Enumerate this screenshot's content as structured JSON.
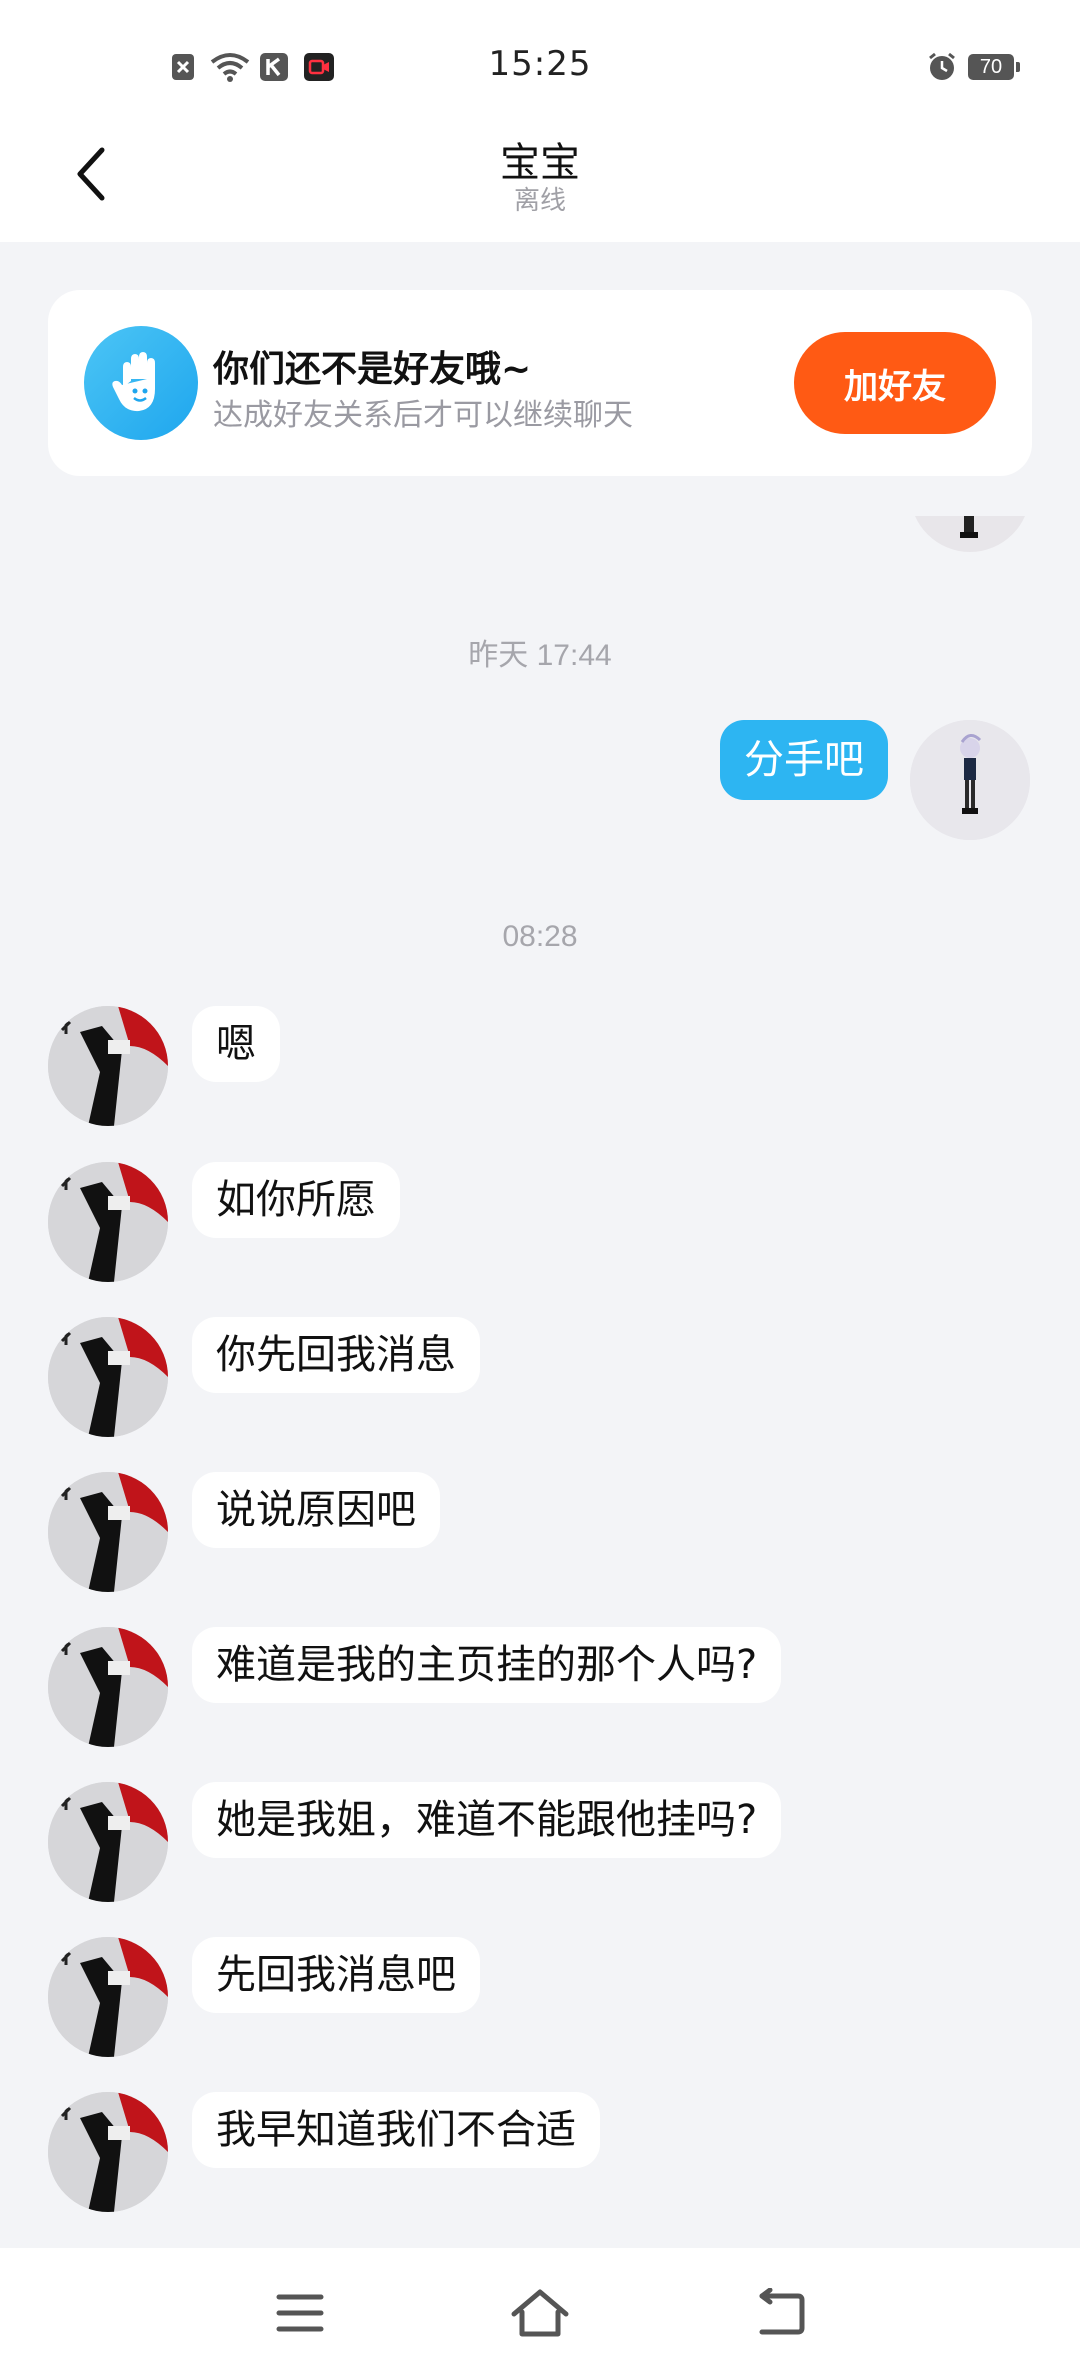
{
  "status_bar": {
    "time": "15:25",
    "battery": "70",
    "icons": [
      "notification-x-icon",
      "wifi-icon",
      "k-app-icon",
      "video-app-icon",
      "alarm-icon",
      "battery-icon"
    ]
  },
  "header": {
    "title": "宝宝",
    "status": "离线"
  },
  "banner": {
    "title": "你们还不是好友哦~",
    "subtitle": "达成好友关系后才可以继续聊天",
    "button": "加好友",
    "accent": "#ff5a14"
  },
  "chat": {
    "timestamps": [
      "昨天 17:44",
      "08:28"
    ],
    "my_messages": [
      "分手吧"
    ],
    "their_messages": [
      "嗯",
      "如你所愿",
      "你先回我消息",
      "说说原因吧",
      "难道是我的主页挂的那个人吗?",
      "她是我姐，难道不能跟他挂吗?",
      "先回我消息吧",
      "我早知道我们不合适"
    ],
    "my_bubble_color": "#2db5f2"
  },
  "nav": {
    "icons": [
      "menu-icon",
      "home-icon",
      "back-nav-icon"
    ]
  }
}
